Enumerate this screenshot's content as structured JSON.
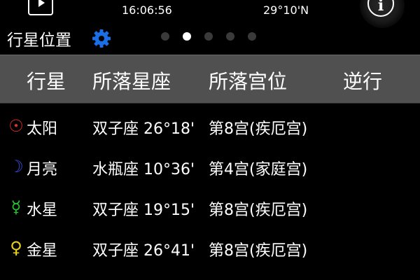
{
  "status": {
    "time": "16:06:56",
    "latitude": "29°10'N"
  },
  "section": {
    "title": "行星位置",
    "gear_icon": "gear-icon",
    "gear_color": "#1a6fe6",
    "page_count": 5,
    "active_page": 2
  },
  "table": {
    "headers": {
      "planet": "行星",
      "sign": "所落星座",
      "house": "所落宫位",
      "retro": "逆行"
    },
    "rows": [
      {
        "icon": "sun-icon",
        "symbol": "☉",
        "color": "#e0302a",
        "name": "太阳",
        "sign": "双子座 26°18'",
        "house": "第8宫(疾厄宫)",
        "retro": ""
      },
      {
        "icon": "moon-icon",
        "symbol": "☽",
        "color": "#3b4fe0",
        "name": "月亮",
        "sign": "水瓶座 10°36'",
        "house": "第4宫(家庭宫)",
        "retro": ""
      },
      {
        "icon": "mercury-icon",
        "symbol": "☿",
        "color": "#26c43a",
        "name": "水星",
        "sign": "双子座 19°15'",
        "house": "第8宫(疾厄宫)",
        "retro": ""
      },
      {
        "icon": "venus-icon",
        "symbol": "♀",
        "color": "#e8d21a",
        "name": "金星",
        "sign": "双子座 26°41'",
        "house": "第8宫(疾厄宫)",
        "retro": ""
      }
    ]
  }
}
